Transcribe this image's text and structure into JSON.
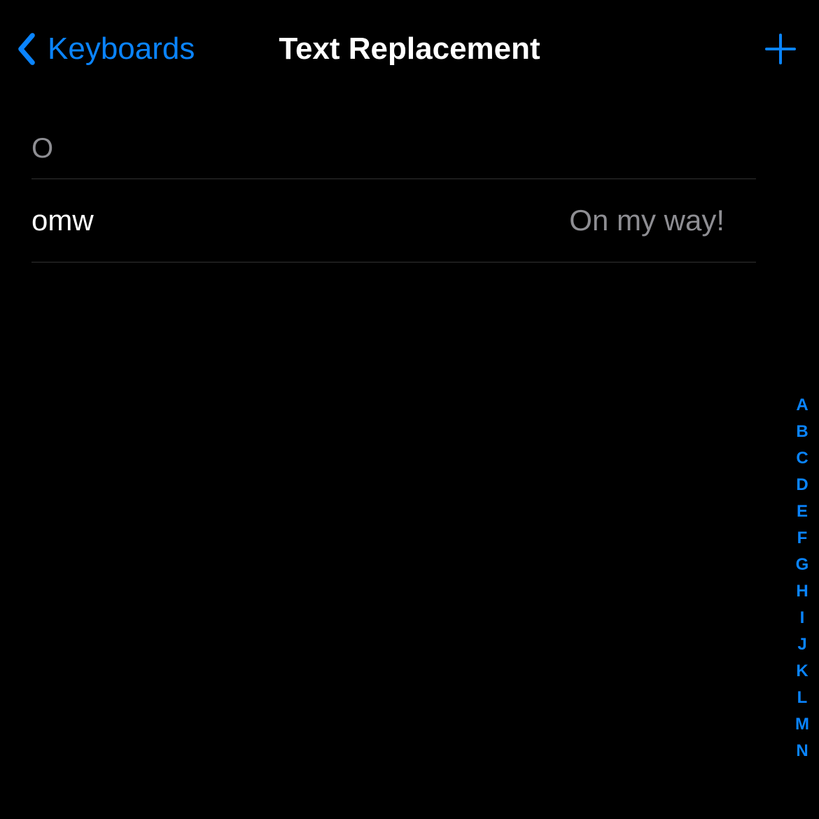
{
  "nav": {
    "back_label": "Keyboards",
    "title": "Text Replacement"
  },
  "section": {
    "header": "O"
  },
  "entries": [
    {
      "shortcut": "omw",
      "phrase": "On my way!"
    }
  ],
  "index": [
    "A",
    "B",
    "C",
    "D",
    "E",
    "F",
    "G",
    "H",
    "I",
    "J",
    "K",
    "L",
    "M",
    "N"
  ]
}
